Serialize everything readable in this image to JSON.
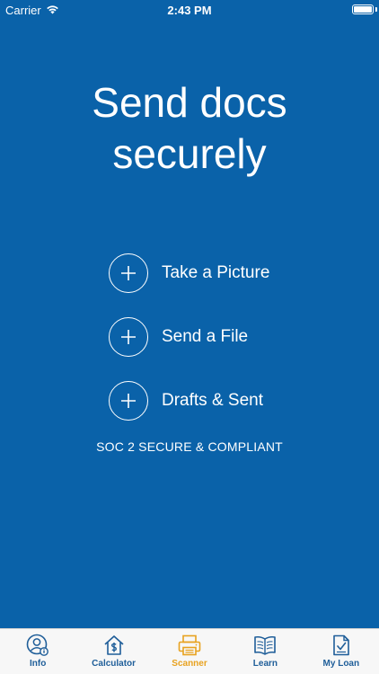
{
  "status_bar": {
    "carrier": "Carrier",
    "time": "2:43 PM"
  },
  "headline": {
    "line1": "Send docs",
    "line2": "securely"
  },
  "actions": [
    {
      "label": "Take a Picture",
      "icon": "plus-circle-icon"
    },
    {
      "label": "Send a File",
      "icon": "plus-circle-icon"
    },
    {
      "label": "Drafts & Sent",
      "icon": "plus-circle-icon"
    }
  ],
  "compliance_note": "SOC 2 SECURE & COMPLIANT",
  "tab_bar": {
    "active_tab": "Scanner",
    "tabs": [
      {
        "label": "Info",
        "icon": "person-info-icon"
      },
      {
        "label": "Calculator",
        "icon": "house-dollar-icon"
      },
      {
        "label": "Scanner",
        "icon": "scanner-icon"
      },
      {
        "label": "Learn",
        "icon": "open-book-icon"
      },
      {
        "label": "My Loan",
        "icon": "document-check-icon"
      }
    ]
  },
  "colors": {
    "background": "#0a62a9",
    "tab_default": "#1f5e99",
    "tab_active": "#e8a21f"
  }
}
